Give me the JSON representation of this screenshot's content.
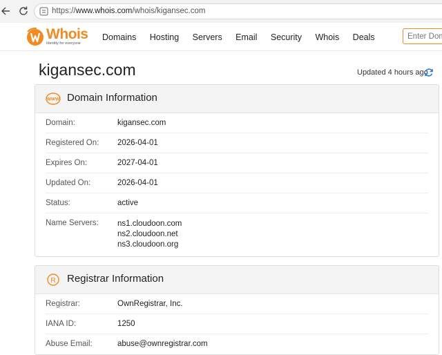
{
  "browser": {
    "url_prefix": "https://",
    "url_host": "www.whois.com",
    "url_path": "/whois/kigansec.com"
  },
  "header": {
    "logo_text": "Whois",
    "logo_tagline": "Identity for everyone",
    "nav": [
      "Domains",
      "Hosting",
      "Servers",
      "Email",
      "Security",
      "Whois",
      "Deals"
    ],
    "search_placeholder": "Enter Domain"
  },
  "page": {
    "domain": "kigansec.com",
    "updated": "Updated 4 hours ago"
  },
  "domain_info": {
    "title": "Domain Information",
    "icon": "www-icon",
    "rows": [
      {
        "label": "Domain:",
        "value": "kigansec.com"
      },
      {
        "label": "Registered On:",
        "value": "2026-04-01"
      },
      {
        "label": "Expires On:",
        "value": "2027-04-01"
      },
      {
        "label": "Updated On:",
        "value": "2026-04-01"
      },
      {
        "label": "Status:",
        "value": "active"
      }
    ],
    "name_servers_label": "Name Servers:",
    "name_servers": [
      "ns1.cloudoon.com",
      "ns2.cloudoon.net",
      "ns3.cloudoon.org"
    ]
  },
  "registrar_info": {
    "title": "Registrar Information",
    "icon": "registered-trademark-icon",
    "rows": [
      {
        "label": "Registrar:",
        "value": "OwnRegistrar, Inc."
      },
      {
        "label": "IANA ID:",
        "value": "1250"
      },
      {
        "label": "Abuse Email:",
        "value": "abuse@ownregistrar.com"
      }
    ]
  },
  "colors": {
    "brand_orange": "#f08a24",
    "accent_blue": "#2a7fd4"
  }
}
